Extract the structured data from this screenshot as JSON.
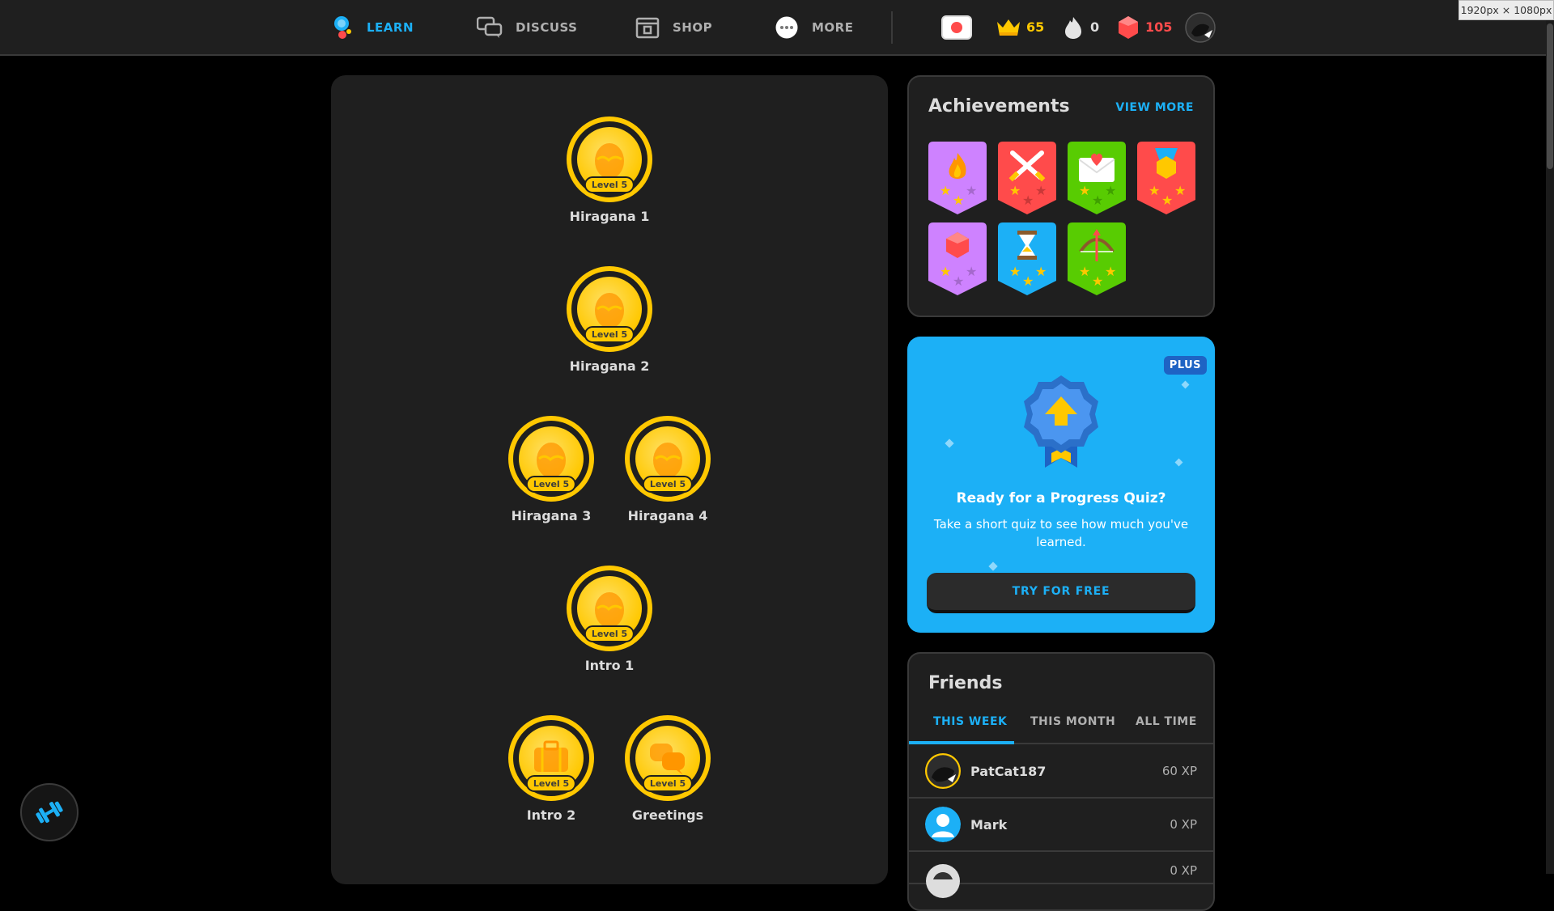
{
  "nav": {
    "learn": "LEARN",
    "discuss": "DISCUSS",
    "shop": "SHOP",
    "more": "MORE"
  },
  "stats": {
    "crowns": "65",
    "streak": "0",
    "gems": "105"
  },
  "size_badge": "1920px × 1080px",
  "tree": {
    "skills": [
      {
        "name": "Hiragana 1",
        "level": "Level 5",
        "icon": "egg-icon"
      },
      {
        "name": "Hiragana 2",
        "level": "Level 5",
        "icon": "egg-icon"
      },
      {
        "name": "Hiragana 3",
        "level": "Level 5",
        "icon": "egg-icon"
      },
      {
        "name": "Hiragana 4",
        "level": "Level 5",
        "icon": "egg-icon"
      },
      {
        "name": "Intro 1",
        "level": "Level 5",
        "icon": "egg-icon"
      },
      {
        "name": "Intro 2",
        "level": "Level 5",
        "icon": "suitcase-icon"
      },
      {
        "name": "Greetings",
        "level": "Level 5",
        "icon": "chat-bubbles-icon"
      }
    ]
  },
  "achievements": {
    "title": "Achievements",
    "view_more": "VIEW MORE",
    "badges": [
      {
        "icon": "flame-icon",
        "color": "#ce82ff"
      },
      {
        "icon": "crossed-swords-icon",
        "color": "#ff4b4b"
      },
      {
        "icon": "love-letter-icon",
        "color": "#58cc02"
      },
      {
        "icon": "medal-icon",
        "color": "#ff4b4b"
      },
      {
        "icon": "gem-icon",
        "color": "#ce82ff"
      },
      {
        "icon": "hourglass-icon",
        "color": "#1cb0f6"
      },
      {
        "icon": "bow-arrow-icon",
        "color": "#58cc02"
      }
    ]
  },
  "plus": {
    "tag": "PLUS",
    "title": "Ready for a Progress Quiz?",
    "text": "Take a short quiz to see how much you've learned.",
    "button": "TRY FOR FREE"
  },
  "friends": {
    "title": "Friends",
    "tabs": [
      "THIS WEEK",
      "THIS MONTH",
      "ALL TIME"
    ],
    "rows": [
      {
        "name": "PatCat187",
        "xp": "60 XP"
      },
      {
        "name": "Mark",
        "xp": "0 XP"
      },
      {
        "name": "",
        "xp": "0 XP"
      }
    ]
  },
  "colors": {
    "accent_blue": "#1cb0f6",
    "gold": "#ffc800",
    "gem_red": "#ff4b4b",
    "bg": "#1f1f1f"
  }
}
